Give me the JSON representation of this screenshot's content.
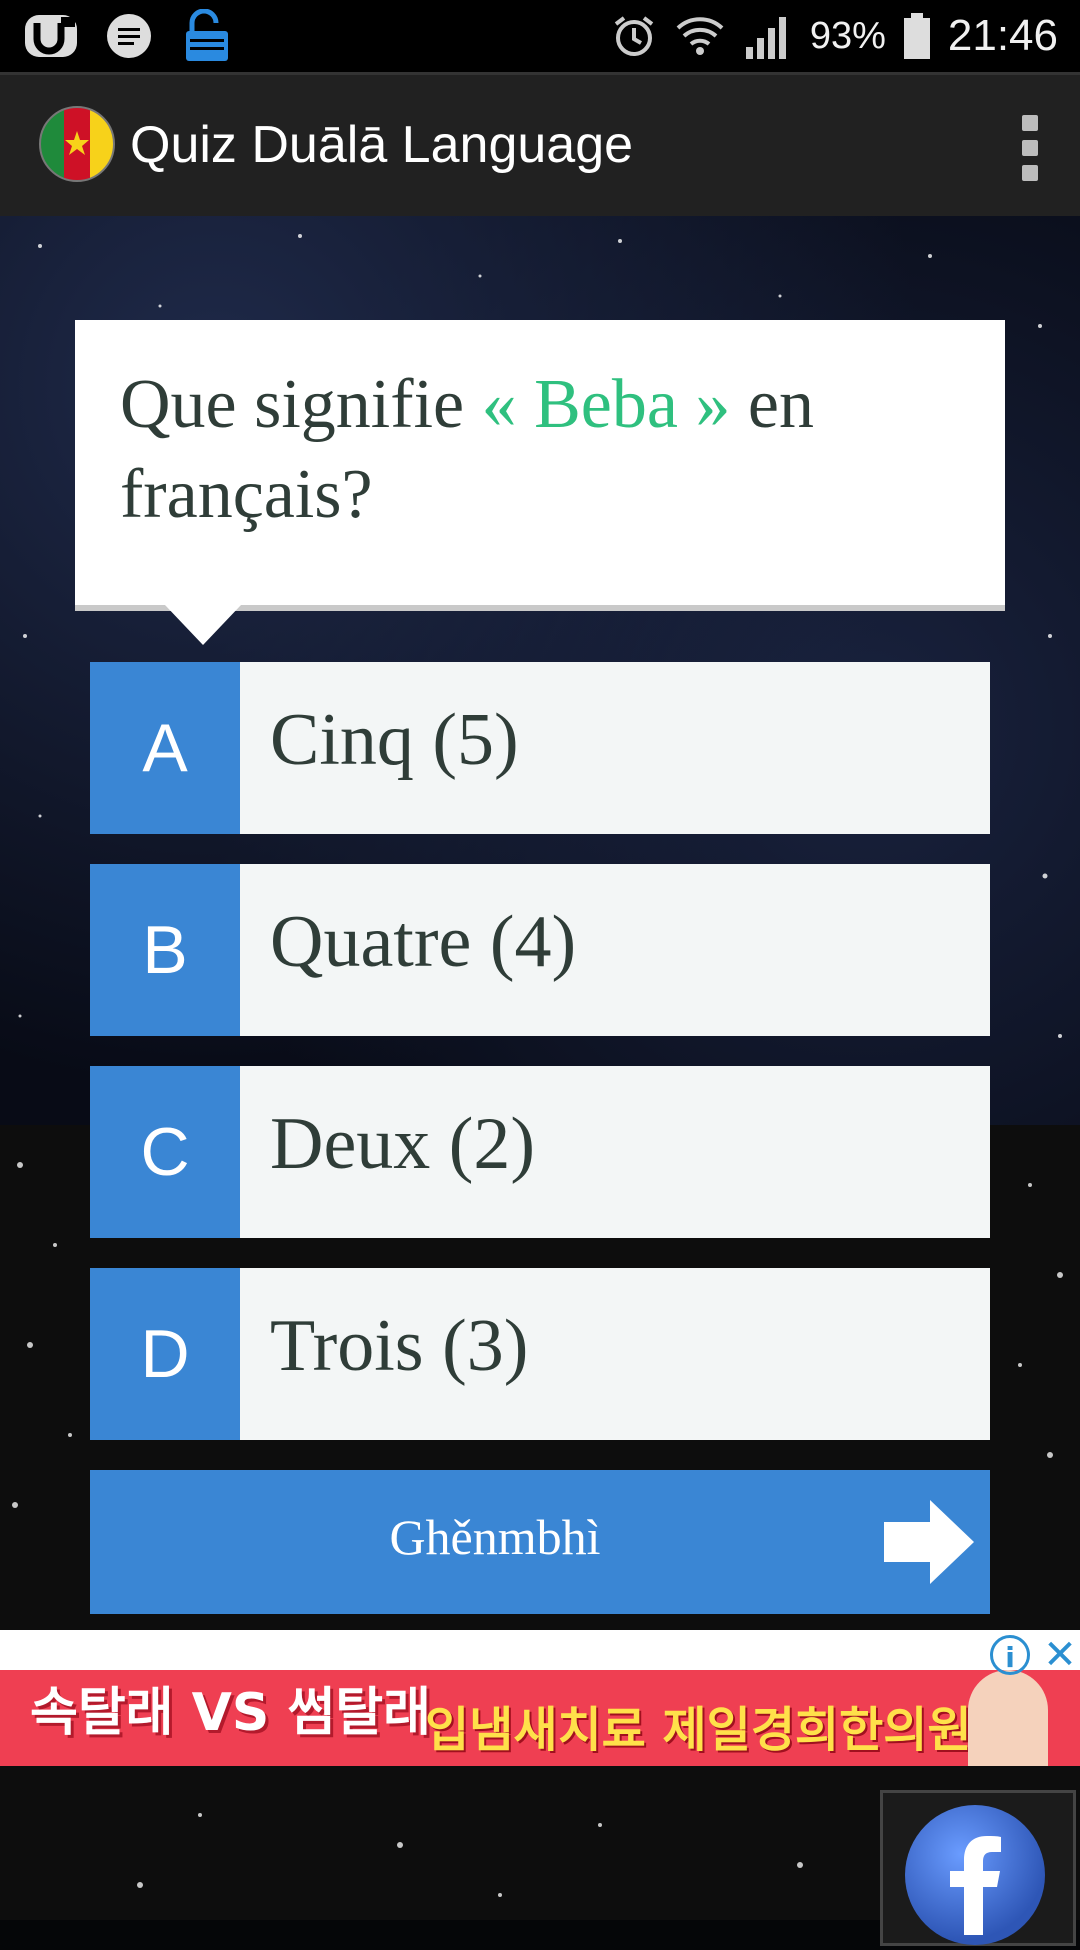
{
  "status_bar": {
    "battery_percent": "93%",
    "time": "21:46"
  },
  "app_bar": {
    "title": "Quiz Duālā Language"
  },
  "question": {
    "prefix": "Que signifie ",
    "highlight": "« Beba »",
    "suffix": " en français?"
  },
  "answers": [
    {
      "letter": "A",
      "text": "Cinq (5)"
    },
    {
      "letter": "B",
      "text": "Quatre (4)"
    },
    {
      "letter": "C",
      "text": "Deux (2)"
    },
    {
      "letter": "D",
      "text": "Trois (3)"
    }
  ],
  "next_button": {
    "label": "Ghěnmbhì"
  },
  "ad": {
    "left_text": "속탈래 VS 썸탈래",
    "right_text": "입냄새치료 제일경희한의원",
    "info": "i",
    "close": "✕"
  },
  "colors": {
    "accent_blue": "#3a86d4",
    "highlight_green": "#2fc07f",
    "question_text": "#2f3d38"
  }
}
